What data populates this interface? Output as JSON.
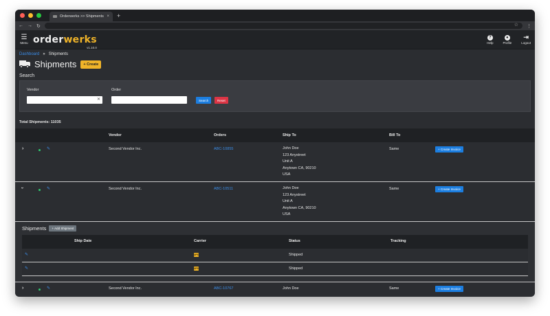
{
  "browser": {
    "tab_title": "Orderwerks >> Shipments",
    "tab_close": "×",
    "new_tab": "+"
  },
  "app": {
    "menu_label": "Menu",
    "logo_prefix": "order",
    "logo_suffix": "werks",
    "version": "v1.10.0",
    "help_label": "Help",
    "profile_label": "Profile",
    "logout_label": "Logout"
  },
  "breadcrumb": {
    "home": "Dashboard",
    "separator": "»",
    "current": "Shipments"
  },
  "page": {
    "title": "Shipments",
    "create_label": "+ Create"
  },
  "search": {
    "heading": "Search",
    "vendor_label": "Vendor",
    "vendor_value": "",
    "order_label": "Order",
    "order_value": "",
    "search_button": "Search",
    "reset_button": "Reset"
  },
  "summary": {
    "total_label": "Total Shipments: 11035"
  },
  "table": {
    "headers": {
      "vendor": "Vendor",
      "orders": "Orders",
      "ship_to": "Ship To",
      "bill_to": "Bill To"
    },
    "rows": [
      {
        "vendor": "Second Vendor Inc.",
        "order": "ABC-10855",
        "ship_to": [
          "John Doe",
          "123 Anystreet",
          "Unit A",
          "Anytown CA, 90210",
          "USA"
        ],
        "bill_to": "Same",
        "action": "+ Create Invoice"
      },
      {
        "vendor": "Second Vendor Inc.",
        "order": "ABC-10511",
        "ship_to": [
          "John Doe",
          "123 Anystreet",
          "Unit A",
          "Anytown CA, 90210",
          "USA"
        ],
        "bill_to": "Same",
        "action": "+ Create Invoice"
      },
      {
        "vendor": "Second Vendor Inc.",
        "order": "ABC-10767",
        "ship_to": [
          "John Doe"
        ],
        "bill_to": "Same",
        "action": "+ Create Invoice"
      }
    ]
  },
  "shipments_sub": {
    "title": "Shipments",
    "add_label": "+ Add Shipment",
    "headers": {
      "ship_date": "Ship Date",
      "carrier": "Carrier",
      "status": "Status",
      "tracking": "Tracking"
    },
    "rows": [
      {
        "ship_date": "",
        "carrier_icon": "ups-icon",
        "status": "Shipped",
        "tracking": ""
      },
      {
        "ship_date": "",
        "carrier_icon": "ups-icon",
        "status": "Shipped",
        "tracking": ""
      }
    ]
  },
  "colors": {
    "accent": "#f0b429",
    "primary": "#1c7ee0",
    "danger": "#dc3545",
    "background": "#2b2d31"
  }
}
